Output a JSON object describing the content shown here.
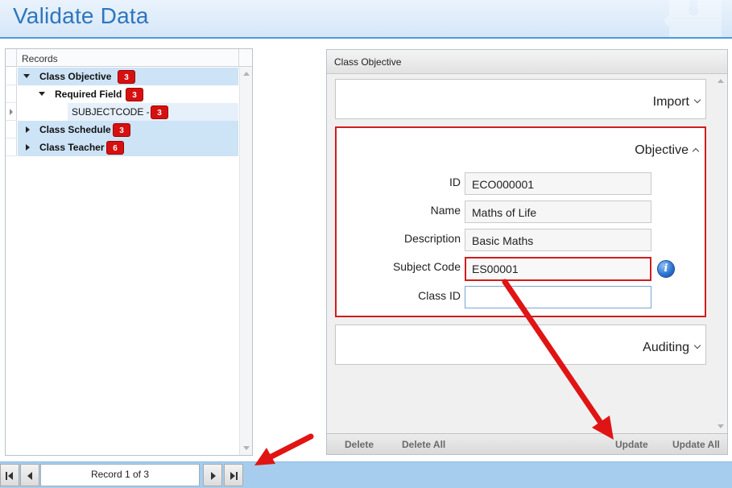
{
  "header": {
    "title": "Validate Data"
  },
  "tree": {
    "column_header": "Records",
    "rows": [
      {
        "label": "Class Objective",
        "count": "3"
      },
      {
        "label": "Required Field",
        "count": "3"
      },
      {
        "label": "SUBJECTCODE -",
        "count": "3"
      },
      {
        "label": "Class Schedule",
        "count": "3"
      },
      {
        "label": "Class Teacher",
        "count": "6"
      }
    ]
  },
  "detail": {
    "title": "Class Objective",
    "sections": {
      "import": "Import",
      "objective": "Objective",
      "auditing": "Auditing"
    },
    "fields": [
      {
        "label": "ID",
        "value": "ECO000001"
      },
      {
        "label": "Name",
        "value": "Maths of Life"
      },
      {
        "label": "Description",
        "value": "Basic Maths"
      },
      {
        "label": "Subject Code",
        "value": "ES00001"
      },
      {
        "label": "Class ID",
        "value": ""
      }
    ],
    "actions": {
      "delete": "Delete",
      "delete_all": "Delete All",
      "update": "Update",
      "update_all": "Update All"
    }
  },
  "navigation": {
    "record_text": "Record 1 of 3"
  },
  "colors": {
    "accent": "#2e76be",
    "error": "#d21c1c",
    "badge": "#d61010",
    "selection": "#cde3f6",
    "annotation_arrow": "#e01414"
  },
  "icons": {
    "puzzle": "puzzle-watermark-icon",
    "info": "info-icon"
  }
}
